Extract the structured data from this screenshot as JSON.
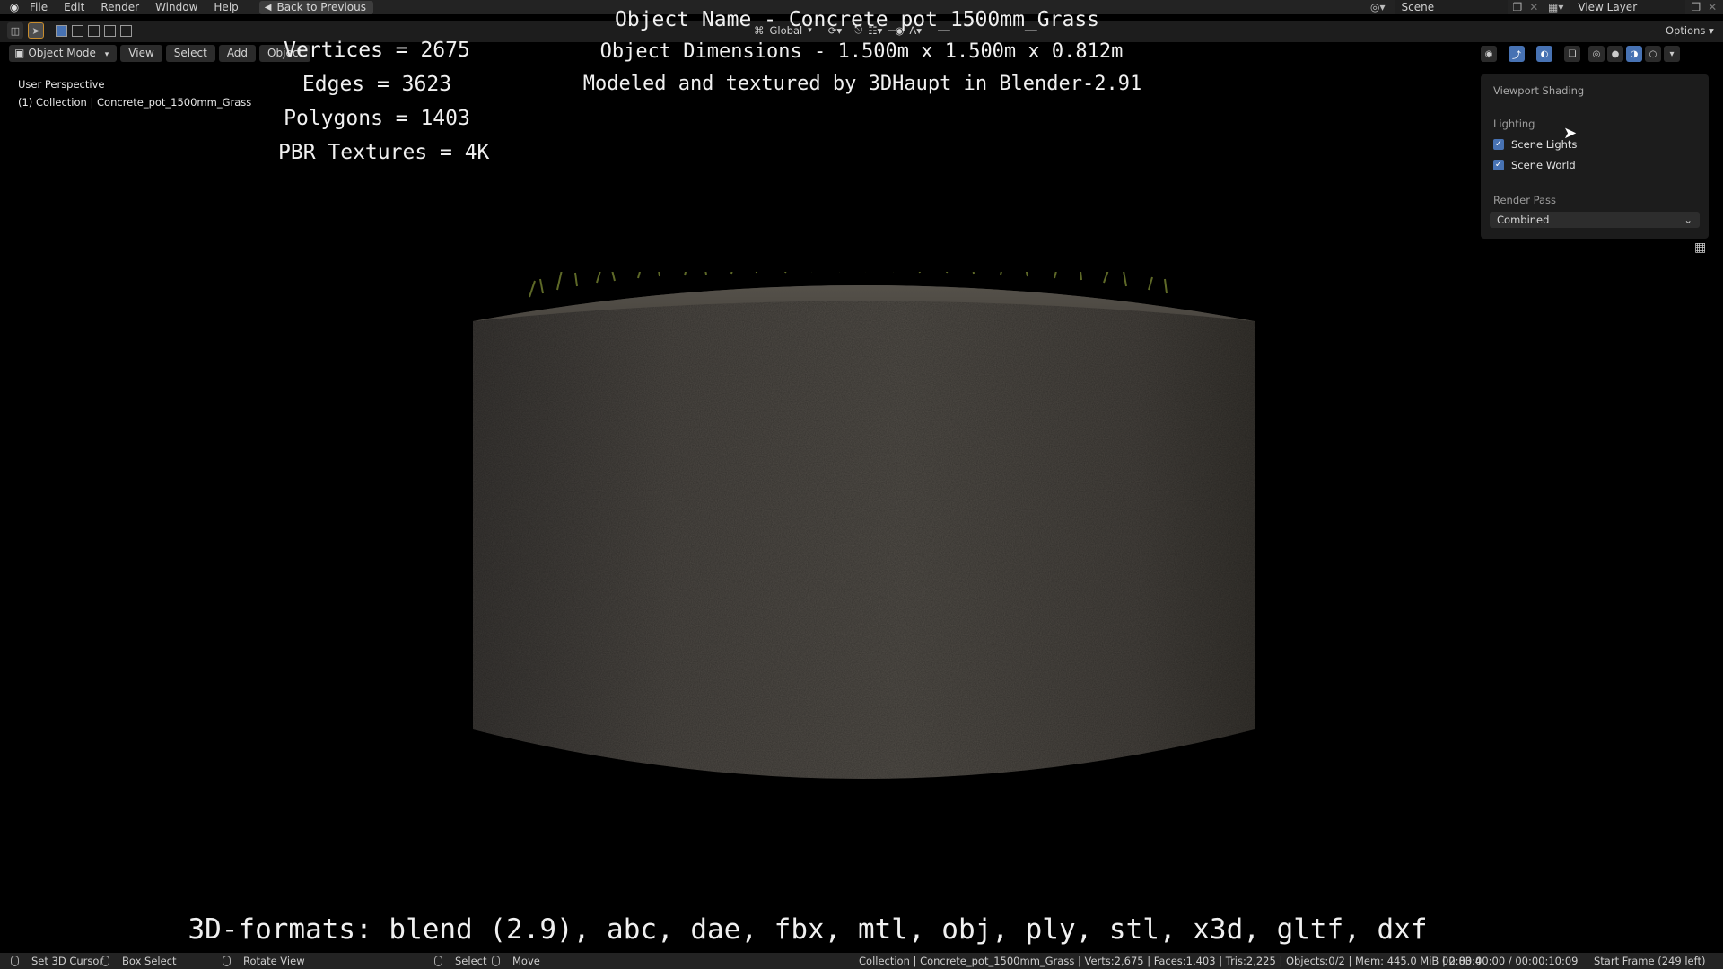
{
  "menubar": {
    "items": [
      "File",
      "Edit",
      "Render",
      "Window",
      "Help"
    ],
    "back_button": "Back to Previous",
    "scene_label": "Scene",
    "view_layer_label": "View Layer"
  },
  "toolbar": {
    "orientation": "Global",
    "options_label": "Options"
  },
  "viewport_header": {
    "mode": "Object Mode",
    "menu": [
      "View",
      "Select",
      "Add",
      "Object"
    ]
  },
  "viewport_info": {
    "perspective": "User Perspective",
    "collection": "(1) Collection | Concrete_pot_1500mm_Grass"
  },
  "overlay": {
    "stats": [
      "Vertices = 2675",
      "Edges = 3623",
      "Polygons = 1403",
      "PBR Textures = 4K"
    ],
    "object_name": "Object Name - Concrete_pot_1500mm_Grass",
    "dimensions": "Object Dimensions -  1.500m x 1.500m x 0.812m",
    "credit": "Modeled and textured by 3DHaupt in Blender-2.91",
    "formats": "3D-formats: blend (2.9), abc, dae, fbx, mtl, obj, ply, stl, x3d, gltf, dxf"
  },
  "shading_panel": {
    "title": "Viewport Shading",
    "lighting_label": "Lighting",
    "scene_lights": "Scene Lights",
    "scene_world": "Scene World",
    "render_pass_label": "Render Pass",
    "render_pass_value": "Combined"
  },
  "statusbar": {
    "set_cursor": "Set 3D Cursor",
    "box_select": "Box Select",
    "rotate_view": "Rotate View",
    "select": "Select",
    "move": "Move",
    "scene_stats": "Collection | Concrete_pot_1500mm_Grass | Verts:2,675 | Faces:1,403 | Tris:2,225 | Objects:0/2 | Mem: 445.0 MiB | 2.83.4",
    "time": "00:00:00:00 / 00:00:10:09",
    "start_frame": "Start Frame (249 left)"
  },
  "colors": {
    "accent": "#4772b3",
    "selected_outline": "#c98d2d",
    "concrete": "#4f4b46",
    "grass": "#6f7b2e"
  }
}
